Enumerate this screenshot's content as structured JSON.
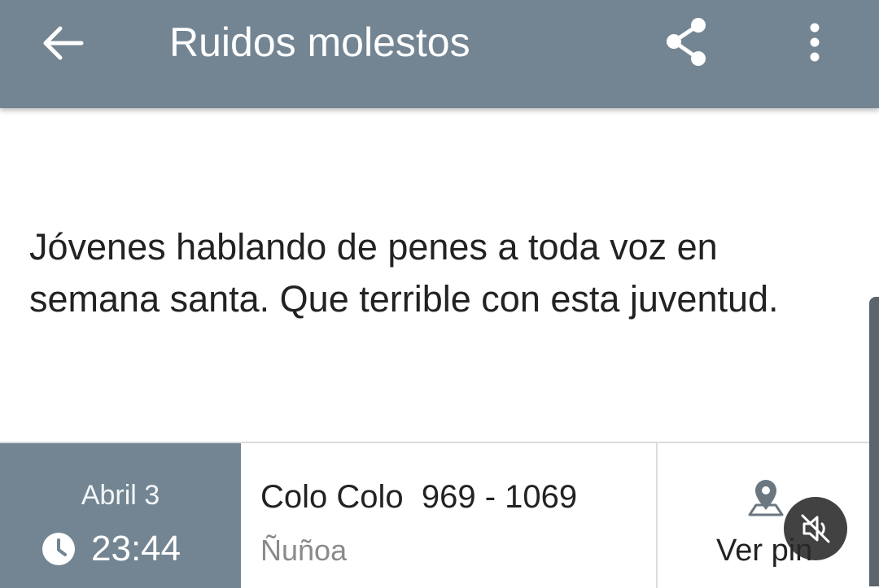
{
  "header": {
    "title": "Ruidos molestos",
    "back_icon": "arrow-left-icon",
    "share_icon": "share-icon",
    "more_icon": "more-vertical-icon",
    "background_color": "#738592"
  },
  "report": {
    "message": "Jóvenes hablando de penes a toda voz en semana santa. Que terrible con esta juventud."
  },
  "info": {
    "date": "Abril 3",
    "time": "23:44",
    "clock_icon": "clock-icon",
    "street": "Colo Colo  969 - 1069",
    "commune": "Ñuñoa",
    "pin_icon": "map-pin-icon",
    "pin_label": "Ver pin"
  },
  "overlay": {
    "mute_icon": "muted-speaker-icon"
  }
}
